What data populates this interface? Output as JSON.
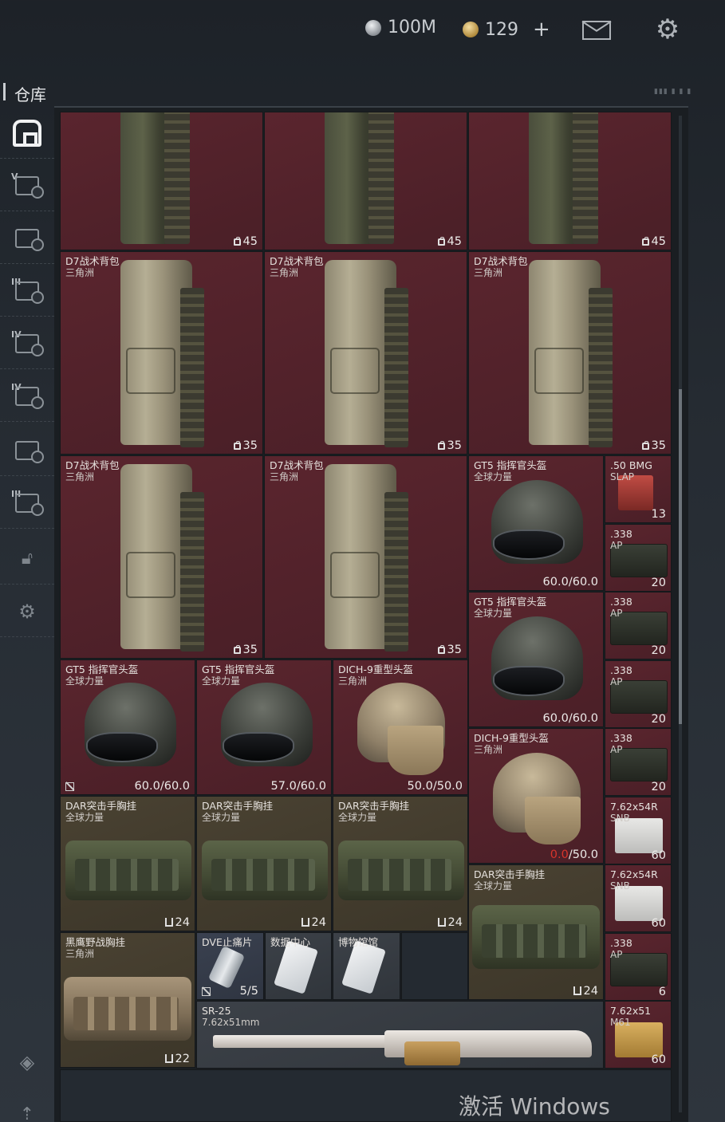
{
  "topbar": {
    "silver_amount": "100M",
    "gold_amount": "129",
    "plus": "+"
  },
  "warehouse": {
    "title": "仓库",
    "right_label": "▮▮▮ ▮ ▮ ▮"
  },
  "sidebar": {
    "items": [
      {
        "icon": "warehouse-icon",
        "label": ""
      },
      {
        "icon": "level-5-weapon-icon",
        "label": "V"
      },
      {
        "icon": "medical-icon",
        "label": ""
      },
      {
        "icon": "level-3-weapon-icon",
        "label": "III"
      },
      {
        "icon": "level-4-weapon-icon",
        "label": "IV"
      },
      {
        "icon": "level-4-folder-icon",
        "label": "IV"
      },
      {
        "icon": "supply-icon",
        "label": ""
      },
      {
        "icon": "level-3-supply-icon",
        "label": "III"
      },
      {
        "icon": "unlock-icon",
        "label": ""
      },
      {
        "icon": "gear-icon",
        "label": ""
      },
      {
        "icon": "layers-icon",
        "label": ""
      },
      {
        "icon": "upload-icon",
        "label": ""
      }
    ]
  },
  "grid": {
    "top_row": [
      {
        "capacity": "45"
      },
      {
        "capacity": "45"
      },
      {
        "capacity": "45"
      }
    ],
    "backpacks_row2": [
      {
        "name": "D7战术背包",
        "source": "三角洲",
        "capacity": "35"
      },
      {
        "name": "D7战术背包",
        "source": "三角洲",
        "capacity": "35"
      },
      {
        "name": "D7战术背包",
        "source": "三角洲",
        "capacity": "35"
      }
    ],
    "backpacks_row3": [
      {
        "name": "D7战术背包",
        "source": "三角洲",
        "capacity": "35"
      },
      {
        "name": "D7战术背包",
        "source": "三角洲",
        "capacity": "35"
      }
    ],
    "helmets_right": [
      {
        "name": "GT5 指挥官头盔",
        "source": "全球力量",
        "durability": "60.0",
        "max": "/60.0"
      },
      {
        "name": "GT5 指挥官头盔",
        "source": "全球力量",
        "durability": "60.0",
        "max": "/60.0"
      },
      {
        "name": "DICH-9重型头盔",
        "source": "三角洲",
        "durability": "0.0",
        "max": "/50.0"
      }
    ],
    "helmets_row": [
      {
        "name": "GT5 指挥官头盔",
        "source": "全球力量",
        "durability": "60.0",
        "max": "/60.0"
      },
      {
        "name": "GT5 指挥官头盔",
        "source": "全球力量",
        "durability": "57.0",
        "max": "/60.0"
      },
      {
        "name": "DICH-9重型头盔",
        "source": "三角洲",
        "durability": "50.0",
        "max": "/50.0"
      }
    ],
    "rigs_row": [
      {
        "name": "DAR突击手胸挂",
        "source": "全球力量",
        "capacity": "24"
      },
      {
        "name": "DAR突击手胸挂",
        "source": "全球力量",
        "capacity": "24"
      },
      {
        "name": "DAR突击手胸挂",
        "source": "全球力量",
        "capacity": "24"
      }
    ],
    "rig_right": {
      "name": "DAR突击手胸挂",
      "source": "全球力量",
      "capacity": "24"
    },
    "rig_hawk": {
      "name": "黑鹰野战胸挂",
      "source": "三角洲",
      "capacity": "22"
    },
    "small_items": [
      {
        "name": "DVE止痛片",
        "count": "5/5"
      },
      {
        "name": "数据中心",
        "count": ""
      },
      {
        "name": "博物馆馆",
        "count": ""
      }
    ],
    "ammo": [
      {
        "name": ".50 BMG",
        "sub": "SLAP",
        "count": "13"
      },
      {
        "name": ".338",
        "sub": "AP",
        "count": "20"
      },
      {
        "name": ".338",
        "sub": "AP",
        "count": "20"
      },
      {
        "name": ".338",
        "sub": "AP",
        "count": "20"
      },
      {
        "name": ".338",
        "sub": "AP",
        "count": "20"
      },
      {
        "name": "7.62x54R",
        "sub": "SNB",
        "count": "60"
      },
      {
        "name": "7.62x54R",
        "sub": "SNB",
        "count": "60"
      },
      {
        "name": ".338",
        "sub": "AP",
        "count": "6"
      },
      {
        "name": "7.62x51",
        "sub": "M61",
        "count": "60"
      }
    ],
    "rifle": {
      "name": "SR-25",
      "caliber": "7.62x51mm"
    }
  },
  "watermark": "激活 Windows",
  "colors": {
    "rare_red": "#5a252e",
    "olive": "#4a4232",
    "blue": "#3a4150",
    "durability_bad": "#d9342b"
  }
}
